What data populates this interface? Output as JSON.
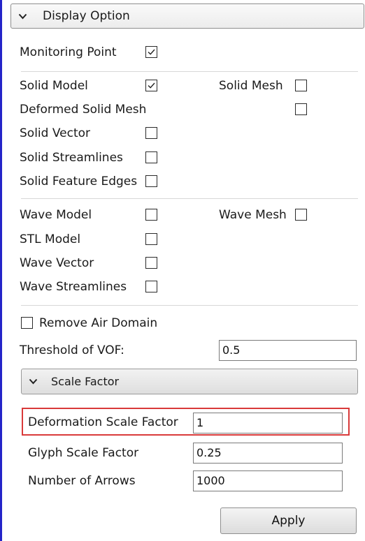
{
  "display_option": {
    "title": "Display Option",
    "monitoring_point": {
      "label": "Monitoring Point",
      "checked": true
    },
    "solid_model": {
      "label": "Solid Model",
      "checked": true
    },
    "solid_mesh": {
      "label": "Solid Mesh",
      "checked": false
    },
    "deformed_solid_mesh": {
      "label": "Deformed Solid Mesh",
      "checked": false
    },
    "solid_vector": {
      "label": "Solid Vector",
      "checked": false
    },
    "solid_streamlines": {
      "label": "Solid Streamlines",
      "checked": false
    },
    "solid_feature_edges": {
      "label": "Solid Feature Edges",
      "checked": false
    },
    "wave_model": {
      "label": "Wave Model",
      "checked": false
    },
    "wave_mesh": {
      "label": "Wave Mesh",
      "checked": false
    },
    "stl_model": {
      "label": "STL Model",
      "checked": false
    },
    "wave_vector": {
      "label": "Wave Vector",
      "checked": false
    },
    "wave_streamlines": {
      "label": "Wave Streamlines",
      "checked": false
    },
    "remove_air_domain": {
      "label": "Remove Air Domain",
      "checked": false
    },
    "threshold_vof": {
      "label": "Threshold of VOF:",
      "value": "0.5"
    }
  },
  "scale_factor": {
    "title": "Scale Factor",
    "deformation": {
      "label": "Deformation Scale Factor",
      "value": "1"
    },
    "glyph": {
      "label": "Glyph Scale Factor",
      "value": "0.25"
    },
    "arrows": {
      "label": "Number of Arrows",
      "value": "1000"
    }
  },
  "apply_label": "Apply",
  "colors": {
    "panel_border": "#2424c8",
    "highlight": "#d93a3a"
  },
  "icons": {
    "expanded": "chevron-down-icon",
    "checked": "checkmark-icon"
  }
}
